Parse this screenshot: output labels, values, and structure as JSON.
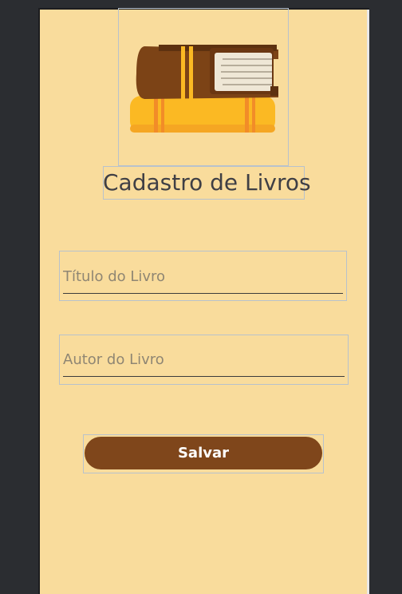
{
  "app": {
    "title": "Cadastro de Livros"
  },
  "hero": {
    "icon": "stacked-books-icon"
  },
  "form": {
    "title_field": {
      "value": "",
      "placeholder": "Título do Livro"
    },
    "author_field": {
      "value": "",
      "placeholder": "Autor do Livro"
    },
    "save_button_label": "Salvar"
  },
  "colors": {
    "background": "#f9dc9c",
    "button": "#7f461b",
    "button_text": "#ffffff",
    "title_text": "#3f3f45",
    "book_brown": "#7c4316",
    "book_yellow": "#fbb923"
  }
}
